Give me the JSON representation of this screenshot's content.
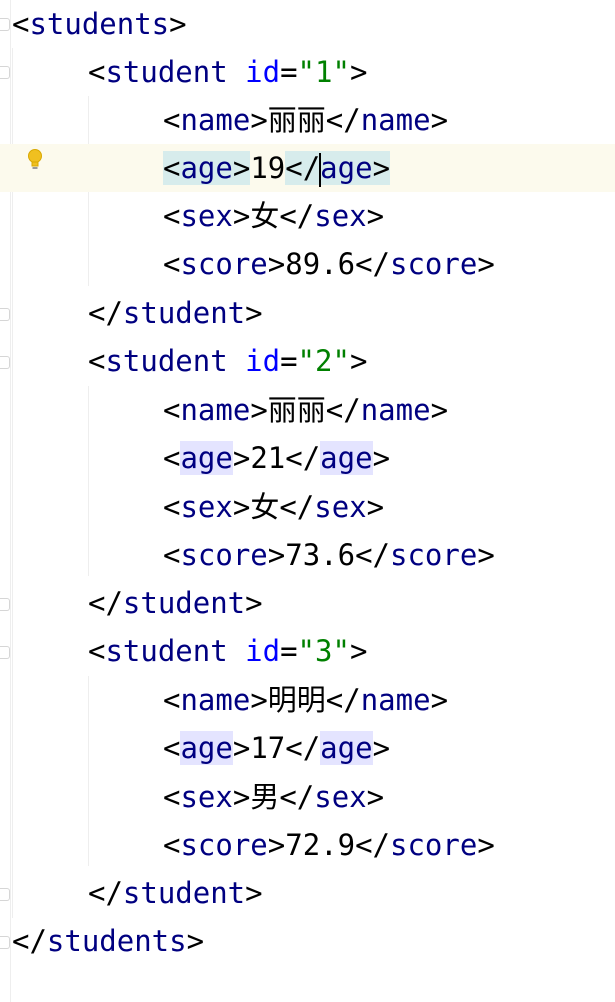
{
  "colors": {
    "tag": "#000080",
    "attribute": "#0000ff",
    "attribute_value": "#008000",
    "text": "#000000",
    "current_line": "#fcfaed",
    "matched_tag_highlight": "#e4e4ff",
    "bulb": "#f0c020"
  },
  "gutter": {
    "intention_icon": "lightbulb-icon"
  },
  "lines": [
    {
      "tag_open": "students"
    },
    {
      "tag_open": "student",
      "attr_name": "id",
      "attr_value": "\"1\""
    },
    {
      "tag": "name",
      "value": "丽丽"
    },
    {
      "tag": "age",
      "value": "19"
    },
    {
      "tag": "sex",
      "value": "女"
    },
    {
      "tag": "score",
      "value": "89.6"
    },
    {
      "tag_close": "student"
    },
    {
      "tag_open": "student",
      "attr_name": "id",
      "attr_value": "\"2\""
    },
    {
      "tag": "name",
      "value": "丽丽"
    },
    {
      "tag": "age",
      "value": "21"
    },
    {
      "tag": "sex",
      "value": "女"
    },
    {
      "tag": "score",
      "value": "73.6"
    },
    {
      "tag_close": "student"
    },
    {
      "tag_open": "student",
      "attr_name": "id",
      "attr_value": "\"3\""
    },
    {
      "tag": "name",
      "value": "明明"
    },
    {
      "tag": "age",
      "value": "17"
    },
    {
      "tag": "sex",
      "value": "男"
    },
    {
      "tag": "score",
      "value": "72.9"
    },
    {
      "tag_close": "student"
    },
    {
      "tag_close": "students"
    }
  ]
}
